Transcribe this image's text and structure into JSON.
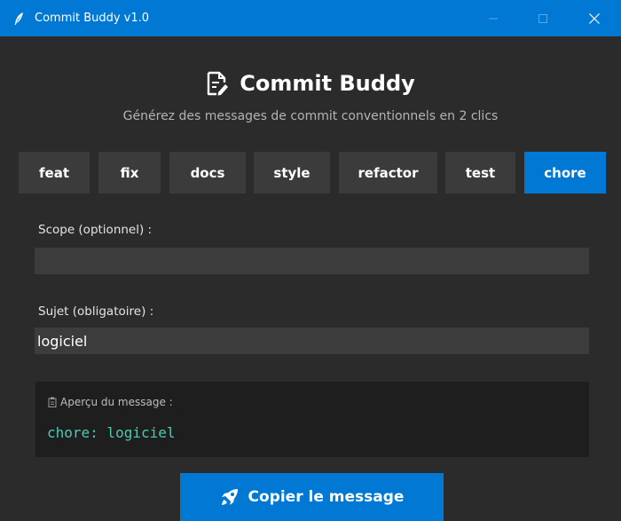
{
  "window": {
    "title": "Commit Buddy v1.0"
  },
  "header": {
    "title": "Commit Buddy",
    "subtitle": "Générez des messages de commit conventionnels en 2 clics"
  },
  "types": {
    "selected": "chore",
    "items": [
      {
        "label": "feat",
        "active": false
      },
      {
        "label": "fix",
        "active": false
      },
      {
        "label": "docs",
        "active": false
      },
      {
        "label": "style",
        "active": false
      },
      {
        "label": "refactor",
        "active": false
      },
      {
        "label": "test",
        "active": false
      },
      {
        "label": "chore",
        "active": true
      }
    ]
  },
  "form": {
    "scope_label": "Scope (optionnel) :",
    "scope_value": "",
    "subject_label": "Sujet (obligatoire) :",
    "subject_value": "logiciel"
  },
  "preview": {
    "title": "Aperçu du message :",
    "message": "chore: logiciel"
  },
  "actions": {
    "copy_label": "Copier le message"
  },
  "colors": {
    "accent": "#0078d4",
    "background": "#2b2b2b",
    "button_bg": "#3b3b3b",
    "input_bg": "#3c3c3c",
    "preview_bg": "#1e1e1e",
    "preview_text": "#4ec9b0"
  },
  "icons": {
    "app": "feather-icon",
    "heading": "document-edit-icon",
    "preview": "clipboard-icon",
    "copy": "rocket-icon"
  }
}
